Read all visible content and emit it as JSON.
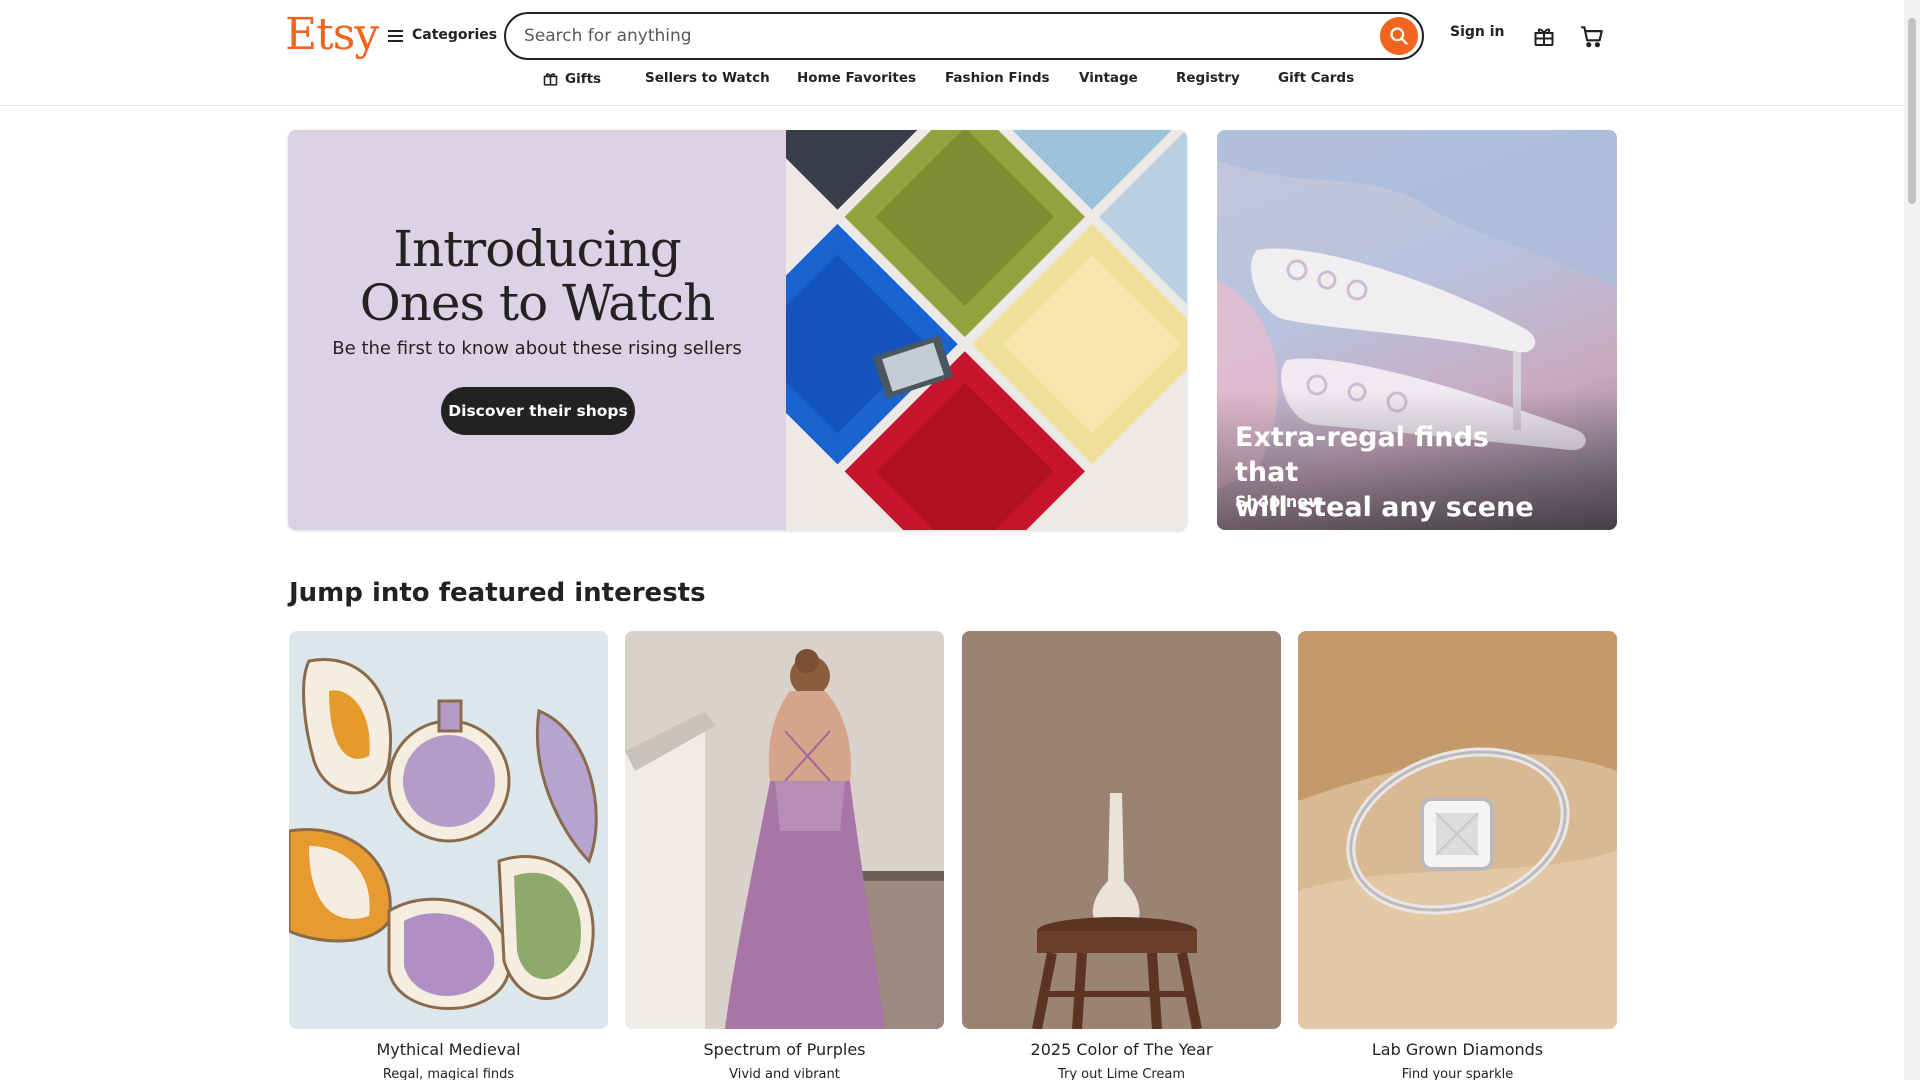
{
  "header": {
    "logo": "Etsy",
    "categories_label": "Categories",
    "search_placeholder": "Search for anything",
    "sign_in": "Sign in",
    "icons": {
      "search": "search-icon",
      "gift": "gift-icon",
      "cart": "cart-icon",
      "menu": "hamburger-menu-icon"
    }
  },
  "nav": {
    "items": [
      {
        "label": "Gifts",
        "icon": "gift-icon"
      },
      {
        "label": "Sellers to Watch"
      },
      {
        "label": "Home Favorites"
      },
      {
        "label": "Fashion Finds"
      },
      {
        "label": "Vintage"
      },
      {
        "label": "Registry"
      },
      {
        "label": "Gift Cards"
      }
    ]
  },
  "hero": {
    "title_line1": "Introducing",
    "title_line2": "Ones to Watch",
    "subtitle": "Be the first to know about these rising sellers",
    "cta": "Discover their shops",
    "side_title_line1": "Extra-regal finds that",
    "side_title_line2": "will steal any scene",
    "side_link": "Shop now"
  },
  "featured": {
    "title": "Jump into featured interests",
    "cards": [
      {
        "title": "Mythical Medieval",
        "subtitle": "Regal, magical finds"
      },
      {
        "title": "Spectrum of Purples",
        "subtitle": "Vivid and vibrant"
      },
      {
        "title": "2025 Color of The Year",
        "subtitle": "Try out Lime Cream"
      },
      {
        "title": "Lab Grown Diamonds",
        "subtitle": "Find your sparkle"
      }
    ]
  },
  "colors": {
    "brand_orange": "#F1641E",
    "hero_lavender": "#DCD2E5",
    "text_dark": "#222222"
  }
}
